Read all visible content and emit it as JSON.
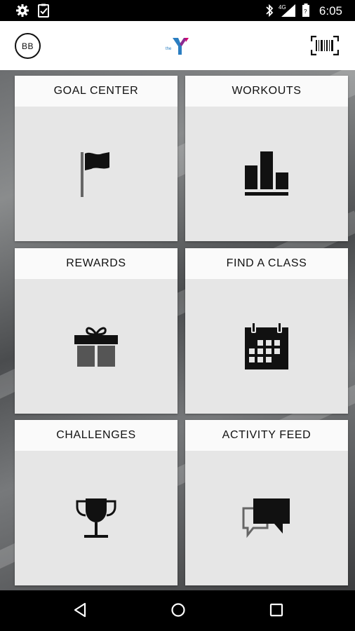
{
  "status_bar": {
    "time": "6:05",
    "left_icons": [
      "settings-icon",
      "clipboard-check-icon"
    ],
    "right_icons": [
      "bluetooth-icon",
      "signal-4g-icon",
      "battery-icon"
    ]
  },
  "app_bar": {
    "avatar_initials": "BB",
    "logo_small_text": "the",
    "logo_icon": "ymca-logo",
    "action_icon": "barcode-scan-icon"
  },
  "tiles": [
    {
      "label": "GOAL CENTER",
      "icon": "flag-icon"
    },
    {
      "label": "WORKOUTS",
      "icon": "bar-chart-icon"
    },
    {
      "label": "REWARDS",
      "icon": "gift-icon"
    },
    {
      "label": "FIND A CLASS",
      "icon": "calendar-icon"
    },
    {
      "label": "CHALLENGES",
      "icon": "trophy-icon"
    },
    {
      "label": "ACTIVITY FEED",
      "icon": "chat-bubbles-icon"
    }
  ],
  "nav_bar": {
    "buttons": [
      "back-icon",
      "home-icon",
      "recents-icon"
    ]
  }
}
